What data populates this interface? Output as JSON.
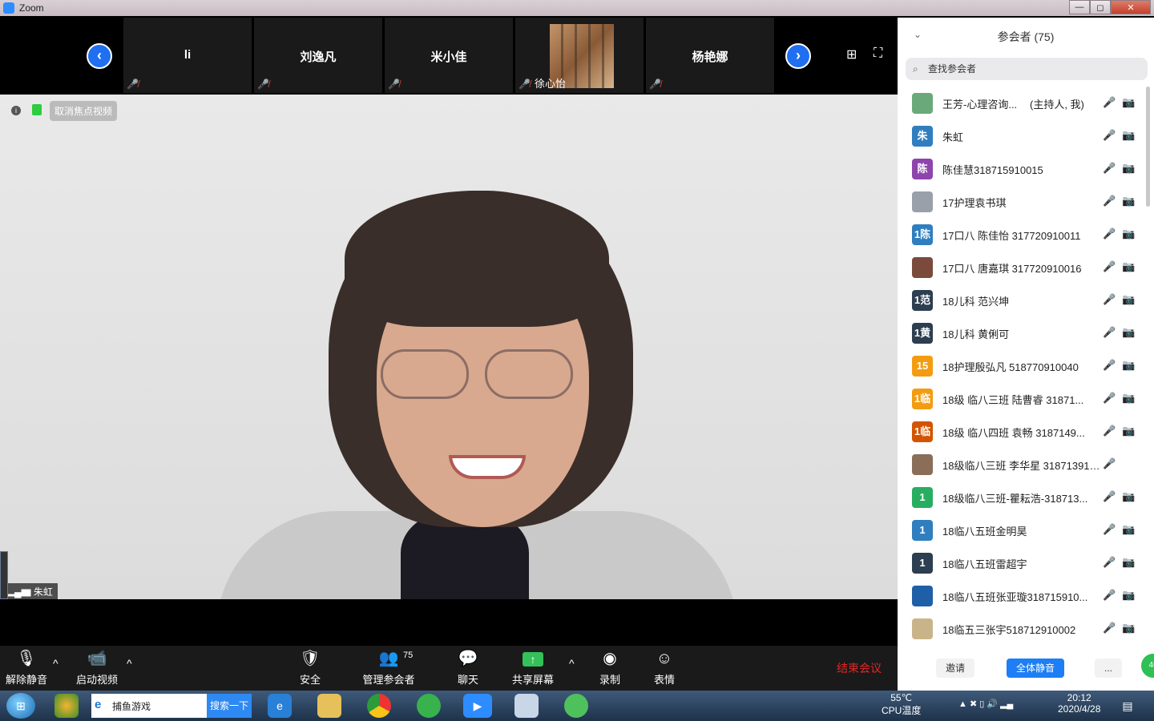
{
  "window": {
    "title": "Zoom",
    "min_label": "—",
    "max_label": "◻",
    "close_label": "✕"
  },
  "strip": {
    "prev_label": "‹",
    "next_label": "›",
    "grid_icon": "⊞",
    "fullscreen_icon": "⛶",
    "thumbnails": [
      {
        "name": "li",
        "caption": ""
      },
      {
        "name": "刘逸凡",
        "caption": ""
      },
      {
        "name": "米小佳",
        "caption": ""
      },
      {
        "name": "",
        "caption": "徐心怡"
      },
      {
        "name": "杨艳娜",
        "caption": ""
      }
    ],
    "muted_icon": "🎤̸"
  },
  "main_video": {
    "info_icon": "i",
    "unpin_label": "取消焦点视频",
    "speaker_name": "朱虹",
    "signal_icon": "▂▄▆"
  },
  "toolbar": {
    "unmute_label": "解除静音",
    "start_video_label": "启动视频",
    "security_label": "安全",
    "manage_label": "管理参会者",
    "participants_count": "75",
    "chat_label": "聊天",
    "share_label": "共享屏幕",
    "record_label": "录制",
    "reactions_label": "表情",
    "end_label": "结束会议",
    "caret": "^"
  },
  "panel": {
    "title": "参会者 (75)",
    "collapse_icon": "⌄",
    "search_placeholder": "查找参会者",
    "participants": [
      {
        "avatar": "",
        "name": "王芳-心理咨询...",
        "role": "(主持人, 我)",
        "avatar_color": "#6aa97a",
        "mic": "🎤",
        "cam": "📷"
      },
      {
        "avatar": "朱",
        "name": "朱虹",
        "role": "",
        "avatar_color": "#2f7ebf",
        "mic": "🎤",
        "cam": "📷"
      },
      {
        "avatar": "陈",
        "name": " 陈佳慧318715910015",
        "role": "",
        "avatar_color": "#8e44ad",
        "mic": "🎤",
        "cam": "📷"
      },
      {
        "avatar": "",
        "name": "17护理袁书琪",
        "role": "",
        "avatar_color": "#9aa0aa",
        "mic": "🎤",
        "cam": "📷"
      },
      {
        "avatar": "1陈",
        "name": "17口八 陈佳怡 317720910011",
        "role": "",
        "avatar_color": "#2f7ebf",
        "mic": "🎤",
        "cam": "📷"
      },
      {
        "avatar": "",
        "name": "17口八 唐嘉琪 317720910016",
        "role": "",
        "avatar_color": "#7a4a3a",
        "mic": "🎤",
        "cam": "📷"
      },
      {
        "avatar": "1范",
        "name": "18儿科 范兴坤",
        "role": "",
        "avatar_color": "#2c3e50",
        "mic": "🎤",
        "cam": "📷"
      },
      {
        "avatar": "1黄",
        "name": "18儿科 黄俐可",
        "role": "",
        "avatar_color": "#2c3e50",
        "mic": "🎤",
        "cam": "📷"
      },
      {
        "avatar": "15",
        "name": "18护理殷弘凡 518770910040",
        "role": "",
        "avatar_color": "#f39c12",
        "mic": "🎤",
        "cam": "📷"
      },
      {
        "avatar": "1临",
        "name": "18级 临八三班 陆曹睿 31871...",
        "role": "",
        "avatar_color": "#f39c12",
        "mic": "🎤",
        "cam": "📷"
      },
      {
        "avatar": "1临",
        "name": "18级 临八四班 袁畅 3187149...",
        "role": "",
        "avatar_color": "#d35400",
        "mic": "🎤",
        "cam": "📷"
      },
      {
        "avatar": "",
        "name": "18级临八三班 李华星 318713910...",
        "role": "",
        "avatar_color": "#8a6e5a",
        "mic": "🎤",
        "cam": ""
      },
      {
        "avatar": "1",
        "name": "18级临八三班-瞿耘浩-318713...",
        "role": "",
        "avatar_color": "#27ae60",
        "mic": "🎤",
        "cam": "📷"
      },
      {
        "avatar": "1",
        "name": "18临八五班金明昊",
        "role": "",
        "avatar_color": "#2f7ebf",
        "mic": "🎤",
        "cam": "📷"
      },
      {
        "avatar": "1",
        "name": "18临八五班雷超宇",
        "role": "",
        "avatar_color": "#2c3e50",
        "mic": "🎤",
        "cam": "📷"
      },
      {
        "avatar": "",
        "name": "18临八五班张亚璇318715910...",
        "role": "",
        "avatar_color": "#1f5fa8",
        "mic": "🎤",
        "cam": "📷"
      },
      {
        "avatar": "",
        "name": "18临五三张宇518712910002",
        "role": "",
        "avatar_color": "#c9b48a",
        "mic": "🎤",
        "cam": "📷"
      }
    ],
    "invite_label": "邀请",
    "mute_all_label": "全体静音",
    "more_label": "...",
    "green_badge": "46"
  },
  "taskbar": {
    "start_icon": "⊞",
    "search_text": "捕鱼游戏",
    "search_button": "搜索一下",
    "temp_value": "55℃",
    "temp_label": "CPU温度",
    "time": "20:12",
    "date": "2020/4/28"
  }
}
